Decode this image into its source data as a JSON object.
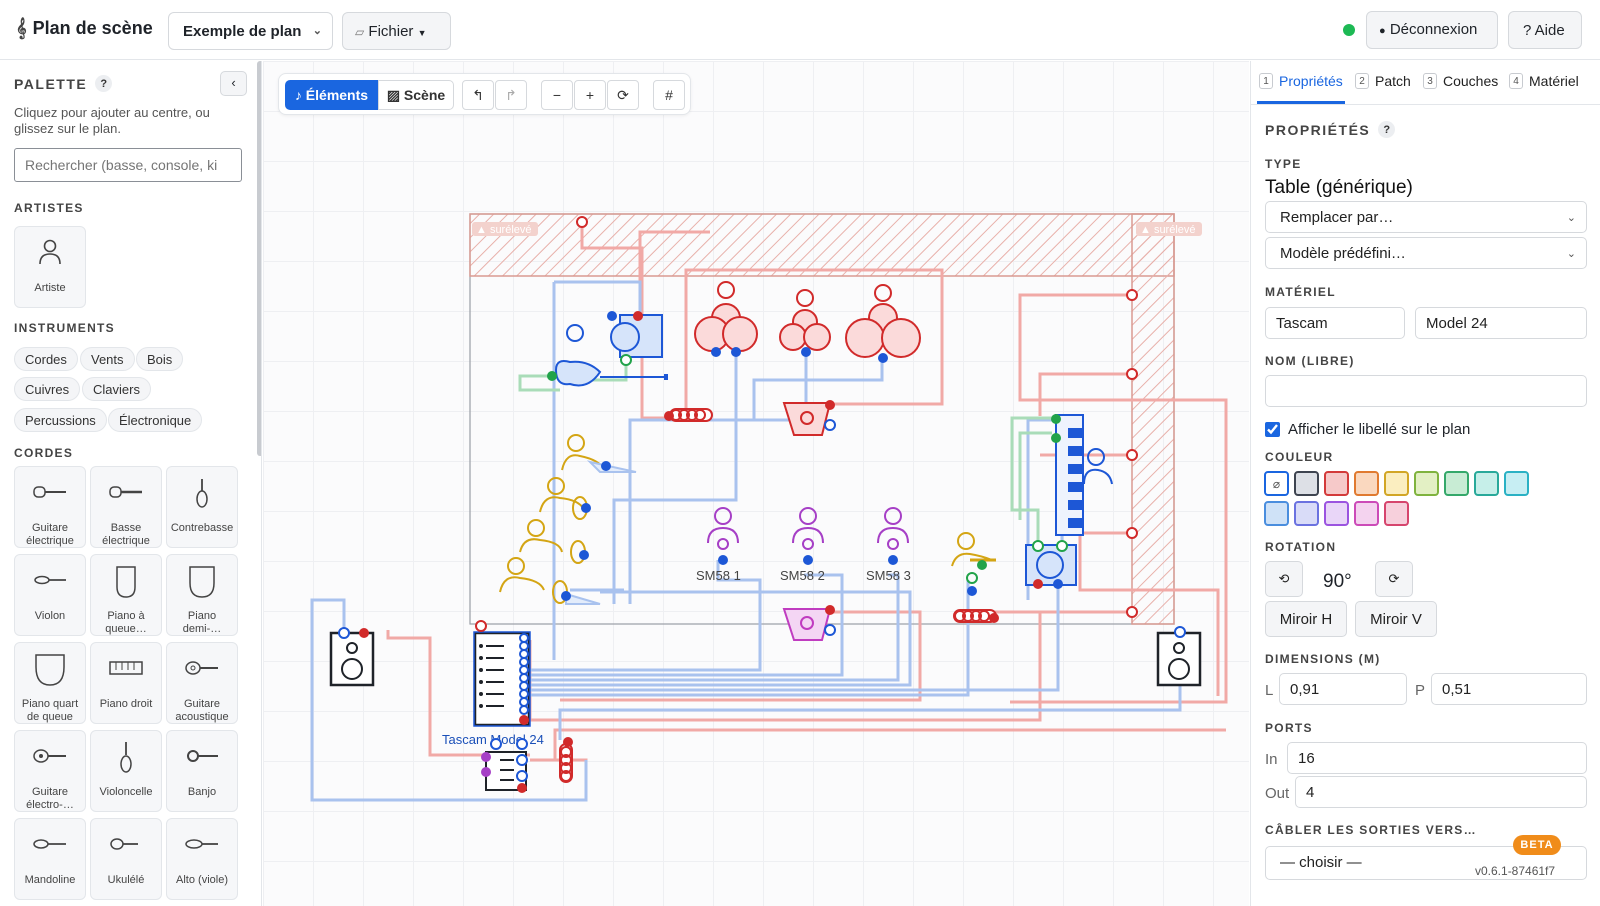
{
  "header": {
    "app_title": "Plan de scène",
    "plan_name": "Exemple de plan",
    "file_menu": "Fichier",
    "logout": "Déconnexion",
    "help": "? Aide"
  },
  "palette": {
    "title": "PALETTE",
    "help": "?",
    "collapse": "‹",
    "hint": "Cliquez pour ajouter au centre, ou glissez sur le plan.",
    "search_placeholder": "Rechercher (basse, console, ki",
    "sections": {
      "artists": "ARTISTES",
      "instruments": "INSTRUMENTS",
      "strings": "CORDES"
    },
    "artist_tile": "Artiste",
    "chips": [
      "Cordes",
      "Vents",
      "Bois",
      "Cuivres",
      "Claviers",
      "Percussions",
      "Électronique"
    ],
    "string_tiles": [
      "Guitare électrique",
      "Basse électrique",
      "Contrebasse",
      "Violon",
      "Piano à queue…",
      "Piano demi-…",
      "Piano quart de queue",
      "Piano droit",
      "Guitare acoustique",
      "Guitare électro-…",
      "Violoncelle",
      "Banjo",
      "Mandoline",
      "Ukulélé",
      "Alto (viole)"
    ]
  },
  "canvas": {
    "toolbar": {
      "elements": "♪ Éléments",
      "scene": "▨ Scène",
      "undo": "↰",
      "redo": "↱",
      "zoom_out": "−",
      "zoom_in": "+",
      "reset": "⟳",
      "grid": "#"
    },
    "riser_label": "▲ surélevé",
    "mic_labels": [
      "SM58 1",
      "SM58 2",
      "SM58 3"
    ],
    "console_label": "Tascam Model 24"
  },
  "properties": {
    "tabs": [
      {
        "num": "1",
        "label": "Propriétés"
      },
      {
        "num": "2",
        "label": "Patch"
      },
      {
        "num": "3",
        "label": "Couches"
      },
      {
        "num": "4",
        "label": "Matériel"
      }
    ],
    "title": "PROPRIÉTÉS",
    "help": "?",
    "type_label": "TYPE",
    "type_value": "Table (générique)",
    "replace_select": "Remplacer par…",
    "preset_select": "Modèle prédéfini…",
    "material_label": "MATÉRIEL",
    "brand": "Tascam",
    "model": "Model 24",
    "name_label": "NOM (LIBRE)",
    "name_value": "",
    "show_label": "Afficher le libellé sur le plan",
    "color_label": "COULEUR",
    "colors": [
      "#dde0e6",
      "#f6c9c9",
      "#fad8bf",
      "#fbeec0",
      "#e3f0c4",
      "#c8ecd4",
      "#c6efe9",
      "#c7eef3",
      "#cfe2f7",
      "#d9dcf8",
      "#e9d6f8",
      "#f4d3ef",
      "#f7d0dc"
    ],
    "color_borders": [
      "#3e4450",
      "#d33a3a",
      "#e07a30",
      "#d2a626",
      "#7fb33e",
      "#34a86a",
      "#28a99a",
      "#2ab1c4",
      "#4a8ede",
      "#6b72e0",
      "#9b54e0",
      "#cc4bb8",
      "#d6456d"
    ],
    "rotation_label": "ROTATION",
    "rotation_value": "90°",
    "rot_left": "⟲",
    "rot_right": "⟳",
    "mirror_h": "Miroir H",
    "mirror_v": "Miroir V",
    "dimensions_label": "DIMENSIONS (M)",
    "dim_l_prefix": "L",
    "dim_l": "0,91",
    "dim_p_prefix": "P",
    "dim_p": "0,51",
    "ports_label": "PORTS",
    "in_prefix": "In",
    "ports_in": "16",
    "out_prefix": "Out",
    "ports_out": "4",
    "cable_label": "CÂBLER LES SORTIES VERS…",
    "cable_select": "— choisir —"
  },
  "footer": {
    "beta": "BETA",
    "version": "v0.6.1-87461f7"
  }
}
